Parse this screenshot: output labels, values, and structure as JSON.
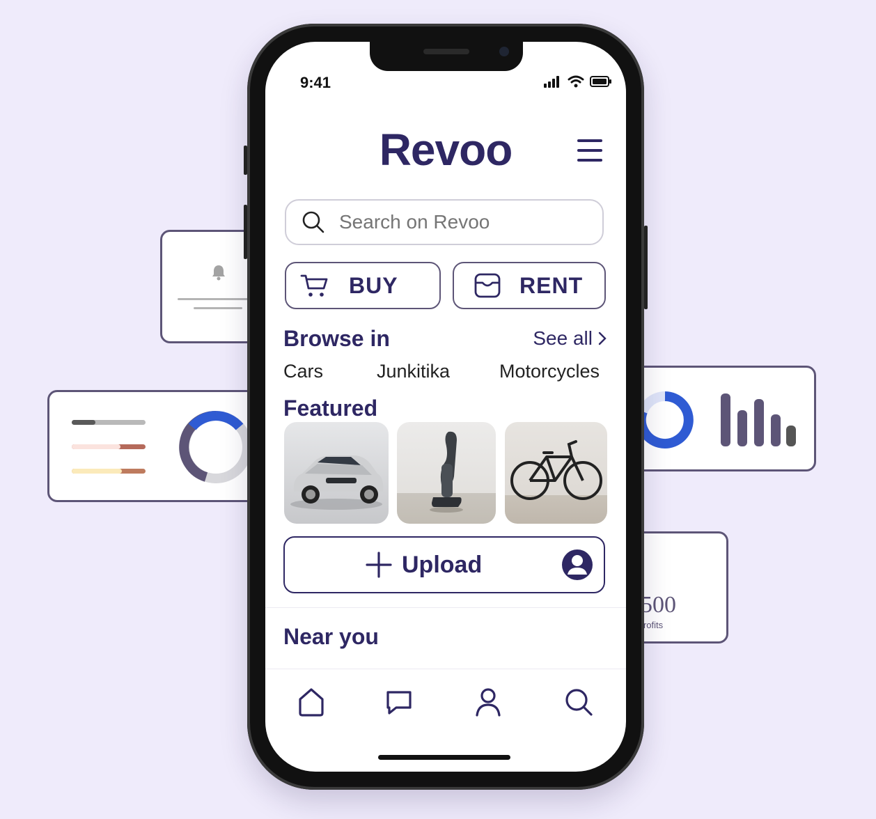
{
  "status": {
    "time": "9:41"
  },
  "app": {
    "brand": "Revoo"
  },
  "search": {
    "placeholder": "Search on Revoo"
  },
  "actions": {
    "buy_label": "BUY",
    "rent_label": "RENT",
    "upload_label": "Upload"
  },
  "browse": {
    "title": "Browse in",
    "see_all": "See all",
    "categories": [
      "Cars",
      "Junkitika",
      "Motorcycles"
    ]
  },
  "featured": {
    "title": "Featured",
    "items": [
      "car",
      "vacuum",
      "bicycle"
    ]
  },
  "near": {
    "title": "Near you"
  },
  "tabbar": [
    "home-icon",
    "chat-icon",
    "profile-icon",
    "search-icon"
  ],
  "profit_card": {
    "value": "€500",
    "caption": "in profits"
  },
  "colors": {
    "brand": "#2e2763",
    "accent_blue": "#2f5bd3",
    "card_border": "#5d5577",
    "background": "#efebfb"
  }
}
